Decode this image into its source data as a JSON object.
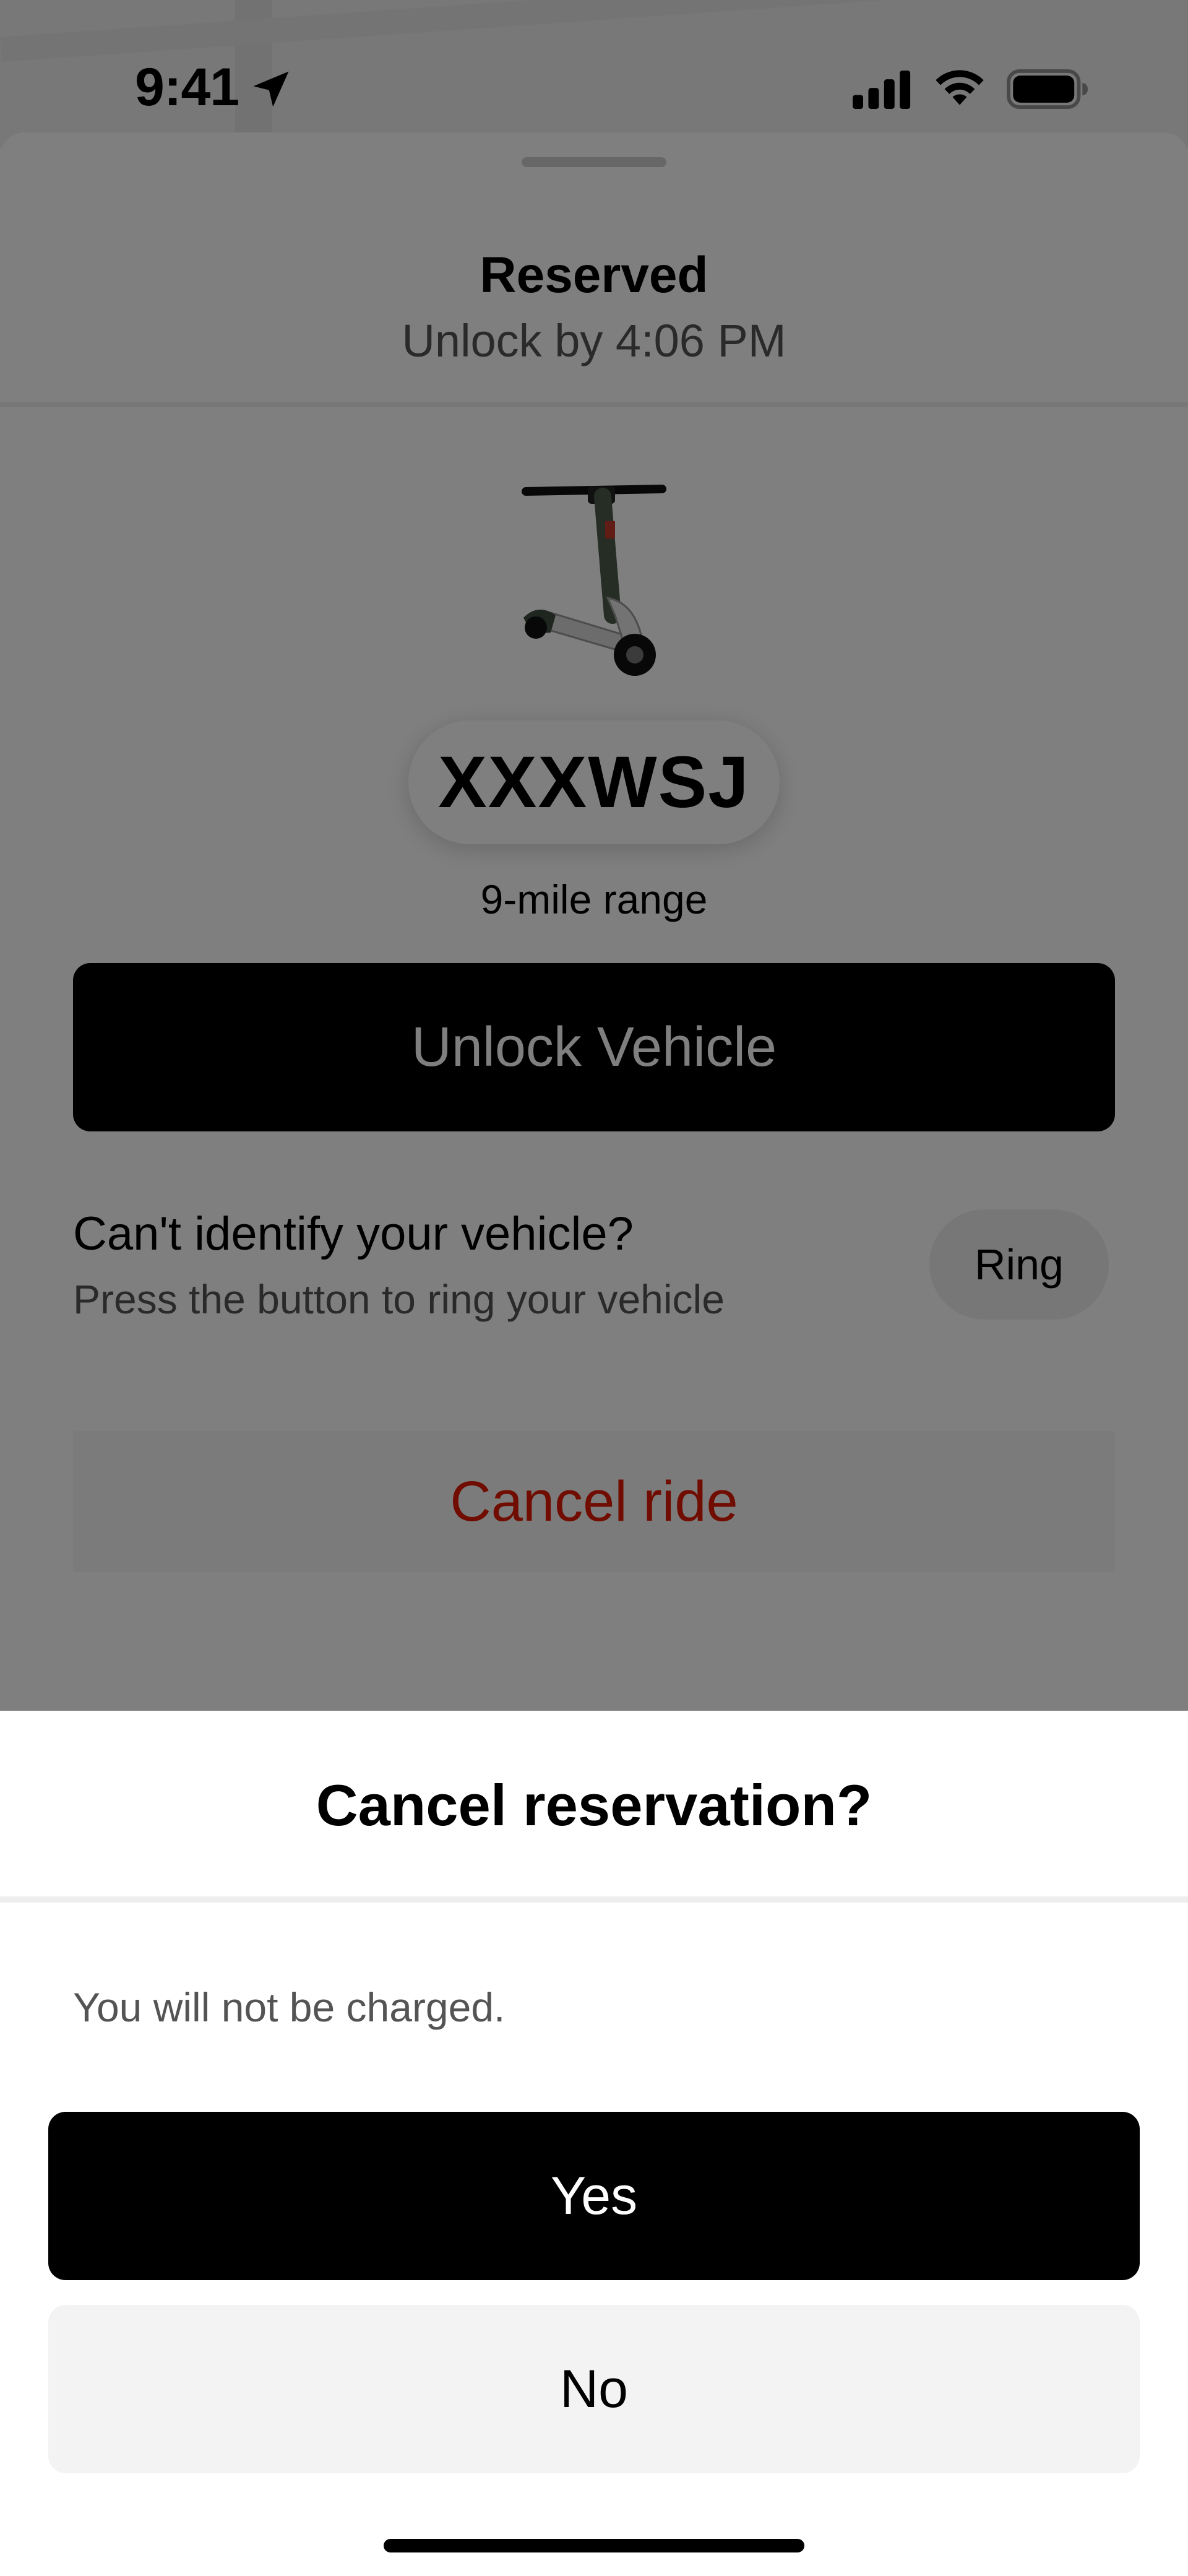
{
  "status_bar": {
    "time": "9:41",
    "icons": [
      "location-arrow-icon",
      "cellular-signal-icon",
      "wifi-icon",
      "battery-icon"
    ]
  },
  "reservation": {
    "title": "Reserved",
    "subtitle": "Unlock by 4:06 PM",
    "vehicle_image": "scooter-image",
    "vehicle_id": "XXXWSJ",
    "range": "9-mile range",
    "unlock_label": "Unlock Vehicle",
    "ring_question": "Can't identify your vehicle?",
    "ring_hint": "Press the button to ring your vehicle",
    "ring_label": "Ring",
    "cancel_label": "Cancel ride"
  },
  "modal": {
    "title": "Cancel reservation?",
    "body": "You will not be charged.",
    "yes_label": "Yes",
    "no_label": "No"
  },
  "colors": {
    "accent": "#000000",
    "danger": "#E11900",
    "secondary_text": "#545454",
    "secondary_button": "#F3F3F3"
  }
}
